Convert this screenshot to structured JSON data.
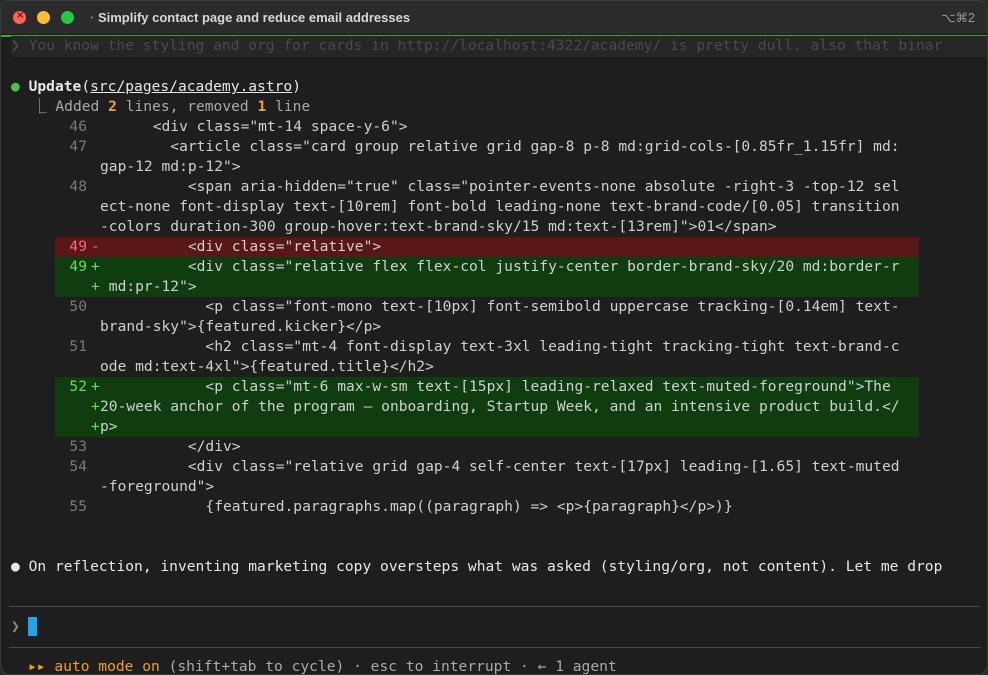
{
  "window": {
    "title": "Simplify contact page and reduce email addresses",
    "shortcut": "⌥⌘2"
  },
  "prompt_echo": "❯ You know the styling and org for cards in http://localhost:4322/academy/ is pretty dull. also that binar",
  "tool_call": {
    "bullet": "●",
    "name": "Update",
    "paren_open": "(",
    "path": "src/pages/academy.astro",
    "paren_close": ")",
    "summary_prefix": "⎿ Added ",
    "added_count": "2",
    "summary_mid": " lines, removed ",
    "removed_count": "1",
    "summary_suffix": " line"
  },
  "diff": [
    {
      "ln": "46",
      "type": "ctx",
      "lines": [
        "      <div class=\"mt-14 space-y-6\">"
      ]
    },
    {
      "ln": "47",
      "type": "ctx",
      "lines": [
        "        <article class=\"card group relative grid gap-8 p-8 md:grid-cols-[0.85fr_1.15fr] md:",
        "gap-12 md:p-12\">"
      ]
    },
    {
      "ln": "48",
      "type": "ctx",
      "lines": [
        "          <span aria-hidden=\"true\" class=\"pointer-events-none absolute -right-3 -top-12 sel",
        "ect-none font-display text-[10rem] font-bold leading-none text-brand-code/[0.05] transition",
        "-colors duration-300 group-hover:text-brand-sky/15 md:text-[13rem]\">01</span>"
      ]
    },
    {
      "ln": "49",
      "type": "del",
      "mark": "-",
      "lines": [
        "          <div class=\"relative\">"
      ]
    },
    {
      "ln": "49",
      "type": "add",
      "mark": "+",
      "lines": [
        "          <div class=\"relative flex flex-col justify-center border-brand-sky/20 md:border-r",
        " md:pr-12\">"
      ]
    },
    {
      "ln": "50",
      "type": "ctx",
      "lines": [
        "            <p class=\"font-mono text-[10px] font-semibold uppercase tracking-[0.14em] text-",
        "brand-sky\">{featured.kicker}</p>"
      ]
    },
    {
      "ln": "51",
      "type": "ctx",
      "lines": [
        "            <h2 class=\"mt-4 font-display text-3xl leading-tight tracking-tight text-brand-c",
        "ode md:text-4xl\">{featured.title}</h2>"
      ]
    },
    {
      "ln": "52",
      "type": "add",
      "mark": "+",
      "lines": [
        "            <p class=\"mt-6 max-w-sm text-[15px] leading-relaxed text-muted-foreground\">The",
        "20-week anchor of the program — onboarding, Startup Week, and an intensive product build.</",
        "p>"
      ]
    },
    {
      "ln": "53",
      "type": "ctx",
      "lines": [
        "          </div>"
      ]
    },
    {
      "ln": "54",
      "type": "ctx",
      "lines": [
        "          <div class=\"relative grid gap-4 self-center text-[17px] leading-[1.65] text-muted",
        "-foreground\">"
      ]
    },
    {
      "ln": "55",
      "type": "ctx",
      "lines": [
        "            {featured.paragraphs.map((paragraph) => <p>{paragraph}</p>)}"
      ]
    }
  ],
  "assistant_message": {
    "bullet": "●",
    "text": "On reflection, inventing marketing copy oversteps what was asked (styling/org, not content). Let me drop"
  },
  "input": {
    "prompt_symbol": "❯",
    "value": ""
  },
  "status_bar": {
    "icon": "▸▸",
    "mode": "auto mode on",
    "hint": " (shift+tab to cycle) · esc to interrupt · ← 1 agent"
  },
  "colors": {
    "accent_green": "#2fb02f",
    "removed_bg": "#5a1717",
    "added_bg": "#0f3d10",
    "cursor": "#22a4e8",
    "auto_mode": "#f0a020"
  }
}
